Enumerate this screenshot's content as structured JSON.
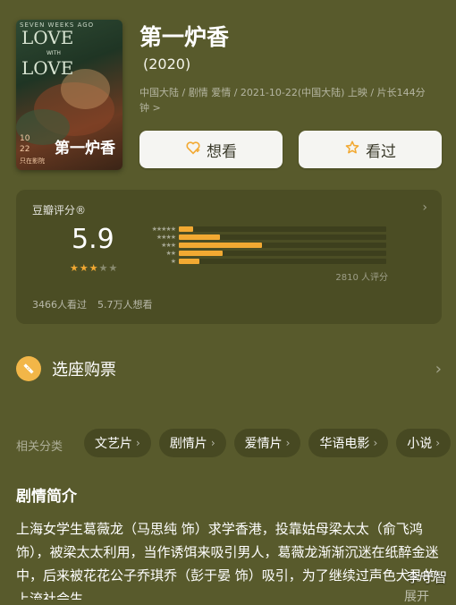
{
  "poster": {
    "top_text": "SEVEN WEEKS AGO",
    "love_line1": "LOVE",
    "with_text": "WITH",
    "love_line2": "LOVE",
    "title_calligraphy": "第一炉香",
    "date1": "10",
    "date2": "22",
    "cinema": "只在影院"
  },
  "movie": {
    "title": "第一炉香",
    "year": "(2020)",
    "meta": "中国大陆 / 剧情 爱情 / 2021-10-22(中国大陆) 上映 / 片长144分钟 >"
  },
  "buttons": {
    "want": "想看",
    "seen": "看过"
  },
  "rating": {
    "label": "豆瓣评分®",
    "arrow": "›",
    "score": "5.9",
    "stars_on": 3,
    "star_glyph_on": "★",
    "star_glyph_off": "★",
    "bar_stars": [
      "★★★★★",
      "★★★★",
      "★★★",
      "★★",
      "★"
    ],
    "distribution": [
      0.07,
      0.2,
      0.4,
      0.21,
      0.1
    ],
    "count_text": "2810 人评分",
    "seen_text": "3466人看过",
    "want_text": "5.7万人想看",
    "accent": "#f2a932"
  },
  "ticket": {
    "label": "选座购票",
    "arrow": "›",
    "icon_color": "#f2b648"
  },
  "categories": {
    "label": "相关分类",
    "items": [
      "文艺片",
      "剧情片",
      "爱情片",
      "华语电影",
      "小说"
    ],
    "chevron": "›"
  },
  "synopsis": {
    "heading": "剧情简介",
    "text": "上海女学生葛薇龙（马思纯 饰）求学香港，投靠姑母梁太太（俞飞鸿 饰），被梁太太利用，当作诱饵来吸引男人，葛薇龙渐渐沉迷在纸醉金迷中，后来被花花公子乔琪乔（彭于晏 饰）吸引，为了继续过声色犬马的上流社会生",
    "expand": "展开"
  },
  "watermark": "李守智",
  "theme": {
    "background": "#585a2c"
  }
}
